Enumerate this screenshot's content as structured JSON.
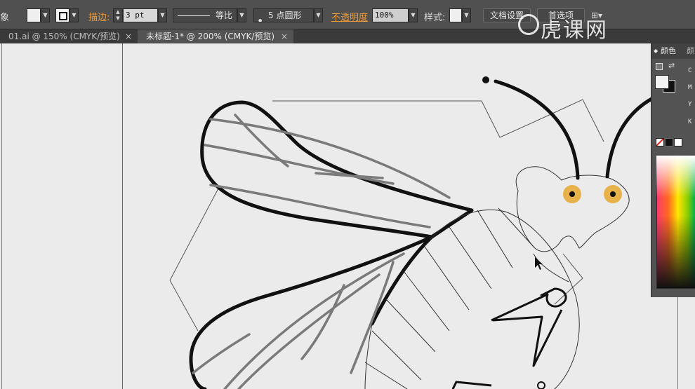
{
  "toolbar": {
    "left_glyph": "象",
    "stroke_label": "描边:",
    "stroke_weight": "3 pt",
    "stroke_profile": "等比",
    "brush": "5 点圆形",
    "opacity_label": "不透明度",
    "opacity_value": "100%",
    "style_label": "样式:",
    "doc_setup": "文档设置",
    "preferences": "首选项"
  },
  "tabs": [
    {
      "label": "01.ai @ 150% (CMYK/预览)",
      "close": "×"
    },
    {
      "label": "未标题-1* @ 200% (CMYK/预览)",
      "close": "×"
    }
  ],
  "color_panel": {
    "tab_color": "颜色",
    "tab_other": "颜",
    "channels": [
      "C",
      "M",
      "Y",
      "K"
    ]
  },
  "watermark": {
    "text": "虎课网"
  },
  "colors": {
    "eye": "#e8b24a",
    "stroke_heavy": "#111111",
    "vein": "#7a7a7a",
    "guide": "#555555",
    "canvas": "#ebebeb"
  }
}
